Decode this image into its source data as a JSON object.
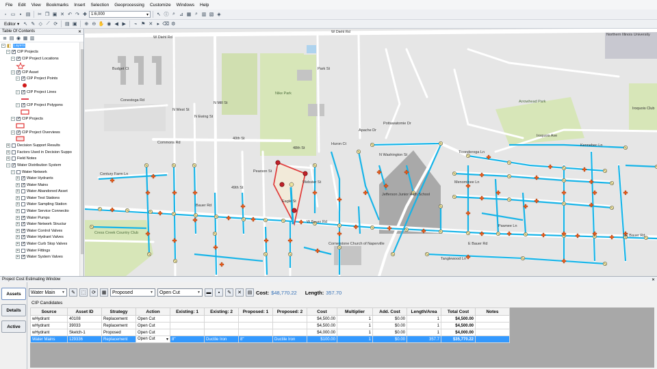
{
  "menu": [
    "File",
    "Edit",
    "View",
    "Bookmarks",
    "Insert",
    "Selection",
    "Geoprocessing",
    "Customize",
    "Windows",
    "Help"
  ],
  "toolbar": {
    "scale": "1:6,000",
    "editor_label": "Editor"
  },
  "toc": {
    "title": "Table Of Contents",
    "rows": [
      {
        "label": "Layers",
        "indent": 0,
        "exp": "−",
        "chk": null,
        "sel": true
      },
      {
        "label": "CIP Projects",
        "indent": 1,
        "exp": "−",
        "chk": "✓"
      },
      {
        "label": "CIP Project Locations",
        "indent": 2,
        "exp": "−",
        "chk": "✓"
      },
      {
        "sym": "star",
        "indent": 3
      },
      {
        "label": "CIP Asset",
        "indent": 2,
        "exp": "−",
        "chk": "✓"
      },
      {
        "label": "CIP Project Points",
        "indent": 3,
        "exp": "−",
        "chk": "✓"
      },
      {
        "sym": "dot",
        "indent": 4
      },
      {
        "label": "CIP Project Lines",
        "indent": 3,
        "exp": "−",
        "chk": "✓"
      },
      {
        "sym": "line",
        "indent": 4
      },
      {
        "label": "CIP Project Polygons",
        "indent": 3,
        "exp": "−",
        "chk": "✓"
      },
      {
        "sym": "rect",
        "indent": 4
      },
      {
        "label": "CIP Projects",
        "indent": 2,
        "exp": "−",
        "chk": "✓"
      },
      {
        "sym": "rect",
        "indent": 3
      },
      {
        "label": "CIP Project Overviews",
        "indent": 2,
        "exp": "−",
        "chk": "✓"
      },
      {
        "sym": "rect2",
        "indent": 3
      },
      {
        "label": "Decision Support Results",
        "indent": 1,
        "exp": "+",
        "chk": ""
      },
      {
        "label": "Factors Used in Decision Suppo",
        "indent": 1,
        "exp": "+",
        "chk": ""
      },
      {
        "label": "Field Notes",
        "indent": 1,
        "exp": "+",
        "chk": ""
      },
      {
        "label": "Water Distribution System",
        "indent": 1,
        "exp": "−",
        "chk": "✓"
      },
      {
        "label": "Water Network",
        "indent": 2,
        "exp": "−",
        "chk": ""
      },
      {
        "label": "Water Hydrants",
        "indent": 3,
        "exp": "+",
        "chk": "✓"
      },
      {
        "label": "Water Mains",
        "indent": 3,
        "exp": "+",
        "chk": "✓"
      },
      {
        "label": "Water Abandoned Asset",
        "indent": 3,
        "exp": "+",
        "chk": ""
      },
      {
        "label": "Water Test Stations",
        "indent": 3,
        "exp": "+",
        "chk": ""
      },
      {
        "label": "Water Sampling Station",
        "indent": 3,
        "exp": "+",
        "chk": ""
      },
      {
        "label": "Water Service Connectio",
        "indent": 3,
        "exp": "+",
        "chk": ""
      },
      {
        "label": "Water Pumps",
        "indent": 3,
        "exp": "+",
        "chk": "✓"
      },
      {
        "label": "Water Network Structur",
        "indent": 3,
        "exp": "+",
        "chk": "✓"
      },
      {
        "label": "Water Control Valves",
        "indent": 3,
        "exp": "+",
        "chk": "✓"
      },
      {
        "label": "Water Hydrant Valves",
        "indent": 3,
        "exp": "+",
        "chk": "✓"
      },
      {
        "label": "Water Curb Stop Valves",
        "indent": 3,
        "exp": "+",
        "chk": "✓"
      },
      {
        "label": "Water Fittings",
        "indent": 3,
        "exp": "+",
        "chk": ""
      },
      {
        "label": "Water System Valves",
        "indent": 3,
        "exp": "+",
        "chk": "✓"
      }
    ]
  },
  "map": {
    "roads": {
      "w_diehl": "W Diehl Rd",
      "bauer": "Bauer Rd",
      "w_bauer": "W Bauer Rd",
      "e_bauer": "E Bauer Rd",
      "commons": "Commons Rd",
      "fortieth": "40th St",
      "fortyninth": "49th St",
      "fortyeighth": "48th St",
      "conestoga": "Conestoga Rd",
      "century_farm": "Century Farm Ln",
      "n_washington": "N Washington St",
      "ticonderoga": "Ticonderoga Ln",
      "menominee": "Menominee Ln",
      "pawnee": "Pawnee Ln",
      "tanglewood": "Tanglewood Ln",
      "iroquois": "Iroquois Ave",
      "kennebec": "Kennebec Ln",
      "n_mill": "N Mill St",
      "park": "Park St",
      "n_west": "N West St",
      "n_ewing": "N Ewing St",
      "pearson": "Pearson St",
      "webster": "Webster St",
      "eagle": "Eagle St",
      "patton": "Patton Rd",
      "budget": "Budget Ct",
      "apache": "Apache Dr",
      "pottawatomie": "Pottawatomie Dr",
      "huron": "Huron Ct"
    },
    "places": {
      "nike_park": "Nike Park",
      "arrowhead_park": "Arrowhead Park",
      "cress_creek": "Cress Creek Country Club",
      "jefferson": "Jefferson Junior High School",
      "cornerstone": "Cornerstone Church of Naperville",
      "niu": "Northern Illinois University",
      "iroquois_club": "Iroquois Club"
    }
  },
  "cost_window": {
    "title": "Project Cost Estimating Window",
    "tabs": [
      "Assets",
      "Details",
      "Active"
    ],
    "active_tab": "Assets",
    "layer_dd": "Water Main",
    "status_dd": "Proposed",
    "method_dd": "Open Cut",
    "cost_label": "Cost:",
    "cost_value": "$48,770.22",
    "length_label": "Length:",
    "length_value": "357.70",
    "section_label": "CIP Candidates",
    "columns": [
      "Source",
      "Asset ID",
      "Strategy",
      "Action",
      "Existing: 1",
      "Existing: 2",
      "Proposed: 1",
      "Proposed: 2",
      "Cost",
      "Multiplier",
      "Add. Cost",
      "Length/Area",
      "Total Cost",
      "Notes"
    ],
    "rows": [
      [
        "wHydrant",
        "40108",
        "Replacement",
        "Open Cut",
        "",
        "",
        "",
        "",
        "$4,500.00",
        "1",
        "$0.00",
        "1",
        "$4,500.00",
        ""
      ],
      [
        "wHydrant",
        "39033",
        "Replacement",
        "Open Cut",
        "",
        "",
        "",
        "",
        "$4,500.00",
        "1",
        "$0.00",
        "1",
        "$4,500.00",
        ""
      ],
      [
        "wHydrant",
        "Sketch-1",
        "Proposed",
        "Open Cut",
        "",
        "",
        "",
        "",
        "$4,000.00",
        "1",
        "$0.00",
        "1",
        "$4,000.00",
        ""
      ],
      [
        "Water Mains",
        "129336",
        "Replacement",
        "Open Cut",
        "8\"",
        "Ductile Iron",
        "8\"",
        "Ductile Iron",
        "$100.00",
        "1",
        "$0.00",
        "357.7",
        "$35,770.22",
        ""
      ]
    ],
    "selected_row": 3
  },
  "colors": {
    "main_line": "#16b4e8",
    "hydrant": "#e85a1a",
    "valve": "#f0e6a0",
    "cip": "#d9283a",
    "park": "#d7e6b8",
    "road": "#ffffff",
    "selection": "#3399ff"
  }
}
